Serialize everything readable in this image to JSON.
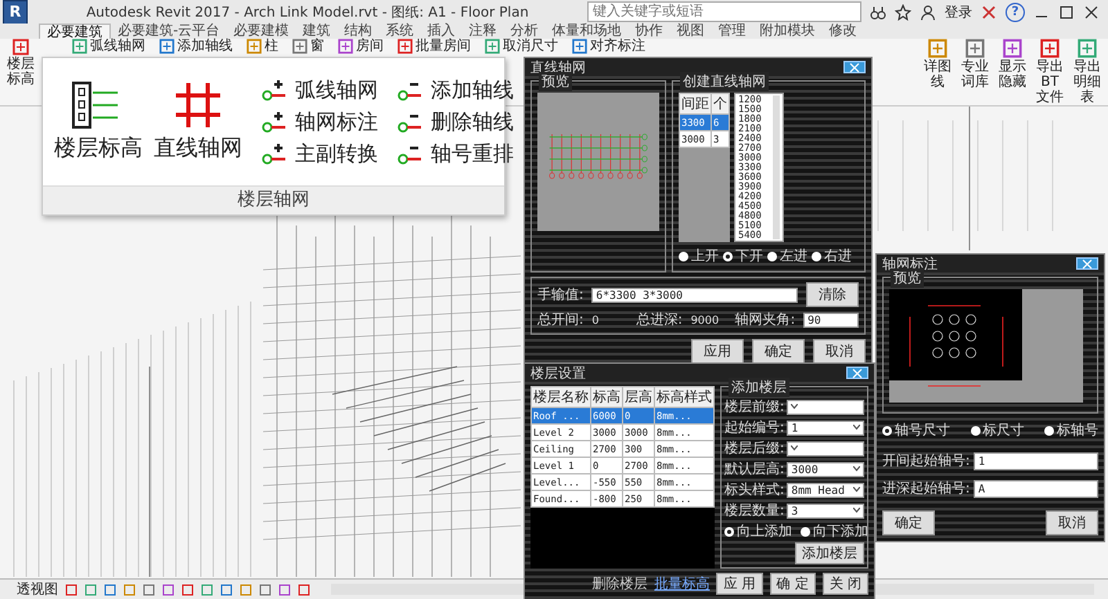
{
  "window": {
    "logo": "R",
    "title": "Autodesk Revit 2017 -   Arch Link Model.rvt - 图纸: A1 - Floor Plan",
    "search": {
      "placeholder": "键入关键字或短语"
    },
    "user": "登录",
    "help": "?"
  },
  "ribbon": {
    "tabs": [
      {
        "label": "必要建筑",
        "selected": true
      },
      {
        "label": "必要建筑-云平台",
        "selected": false
      },
      {
        "label": "必要建模",
        "selected": false
      },
      {
        "label": "建筑",
        "selected": false
      },
      {
        "label": "结构",
        "selected": false
      },
      {
        "label": "系统",
        "selected": false
      },
      {
        "label": "插入",
        "selected": false
      },
      {
        "label": "注释",
        "selected": false
      },
      {
        "label": "分析",
        "selected": false
      },
      {
        "label": "体量和场地",
        "selected": false
      },
      {
        "label": "协作",
        "selected": false
      },
      {
        "label": "视图",
        "selected": false
      },
      {
        "label": "管理",
        "selected": false
      },
      {
        "label": "附加模块",
        "selected": false
      },
      {
        "label": "修改",
        "selected": false
      }
    ],
    "items": [
      {
        "label": "楼层标高",
        "kind": "large"
      },
      {
        "label": "弧线轴网",
        "kind": "small"
      },
      {
        "label": "添加轴线",
        "kind": "small"
      },
      {
        "label": "柱",
        "kind": "small"
      },
      {
        "label": "窗",
        "kind": "small"
      },
      {
        "label": "房间",
        "kind": "small"
      },
      {
        "label": "批量房间",
        "kind": "small"
      },
      {
        "label": "取消尺寸",
        "kind": "small"
      },
      {
        "label": "对齐标注",
        "kind": "small"
      },
      {
        "label": "详图线",
        "kind": "large"
      },
      {
        "label": "专业词库",
        "kind": "large"
      },
      {
        "label": "显示隐藏",
        "kind": "large"
      },
      {
        "label": "导出BT文件",
        "kind": "large"
      },
      {
        "label": "导出明细表",
        "kind": "large"
      }
    ]
  },
  "grid_panel": {
    "large": [
      "楼层标高",
      "直线轴网"
    ],
    "small": [
      "弧线轴网",
      "添加轴线",
      "轴网标注",
      "删除轴线",
      "主副转换",
      "轴号重排"
    ],
    "footer": "楼层轴网"
  },
  "grid_dialog": {
    "title": "直线轴网",
    "preview_label": "预览",
    "create_label": "创建直线轴网",
    "table": {
      "columns": [
        "间距",
        "个"
      ],
      "rows": [
        {
          "cells": [
            "3300",
            "6"
          ],
          "selected": true
        },
        {
          "cells": [
            "3000",
            "3"
          ],
          "selected": false
        }
      ]
    },
    "spacing_list": [
      "1200",
      "1500",
      "1800",
      "2100",
      "2400",
      "2700",
      "3000",
      "3300",
      "3600",
      "3900",
      "4200",
      "4500",
      "4800",
      "5100",
      "5400"
    ],
    "directions": [
      {
        "label": "上开",
        "selected": false
      },
      {
        "label": "下开",
        "selected": true
      },
      {
        "label": "左进",
        "selected": false
      },
      {
        "label": "右进",
        "selected": false
      }
    ],
    "manual": {
      "label": "手输值:",
      "value": "6*3300 3*3000",
      "clear": "清除"
    },
    "totals": [
      {
        "label": "总开间:",
        "value": "0"
      },
      {
        "label": "总进深:",
        "value": "9000"
      }
    ],
    "angle": {
      "label": "轴网夹角:",
      "value": "90"
    },
    "buttons": [
      "应用",
      "确定",
      "取消"
    ]
  },
  "level_dialog": {
    "title": "楼层设置",
    "columns": [
      "楼层名称",
      "标高",
      "层高",
      "标高样式"
    ],
    "rows": [
      {
        "cells": [
          "Roof ...",
          "6000",
          "0",
          "8mm..."
        ],
        "selected": true
      },
      {
        "cells": [
          "Level 2",
          "3000",
          "3000",
          "8mm..."
        ],
        "selected": false
      },
      {
        "cells": [
          "Ceiling",
          "2700",
          "300",
          "8mm..."
        ],
        "selected": false
      },
      {
        "cells": [
          "Level 1",
          "0",
          "2700",
          "8mm..."
        ],
        "selected": false
      },
      {
        "cells": [
          "Level...",
          "-550",
          "550",
          "8mm..."
        ],
        "selected": false
      },
      {
        "cells": [
          "Found...",
          "-800",
          "250",
          "8mm..."
        ],
        "selected": false
      }
    ],
    "add_group": "添加楼层",
    "fields": [
      {
        "label": "楼层前缀:"
      },
      {
        "label": "起始编号:",
        "value": "1"
      },
      {
        "label": "楼层后缀:"
      },
      {
        "label": "默认层高:",
        "value": "3000"
      },
      {
        "label": "标头样式:",
        "value": "8mm Head"
      },
      {
        "label": "楼层数量:",
        "value": "3"
      }
    ],
    "directions": [
      {
        "label": "向上添加",
        "selected": true
      },
      {
        "label": "向下添加",
        "selected": false
      }
    ],
    "add_button": "添加楼层",
    "links": [
      "删除楼层",
      "批量标高"
    ],
    "buttons": [
      "应 用",
      "确 定",
      "关 闭"
    ]
  },
  "axis_dialog": {
    "title": "轴网标注",
    "preview_label": "预览",
    "options": [
      {
        "label": "轴号尺寸",
        "selected": true
      },
      {
        "label": "标尺寸",
        "selected": false
      },
      {
        "label": "标轴号",
        "selected": false
      }
    ],
    "fields": [
      {
        "label": "开间起始轴号:",
        "value": "1"
      },
      {
        "label": "进深起始轴号:",
        "value": "A"
      }
    ],
    "buttons": [
      "确定",
      "取消"
    ]
  },
  "status_bar": {
    "view": "透视图"
  }
}
